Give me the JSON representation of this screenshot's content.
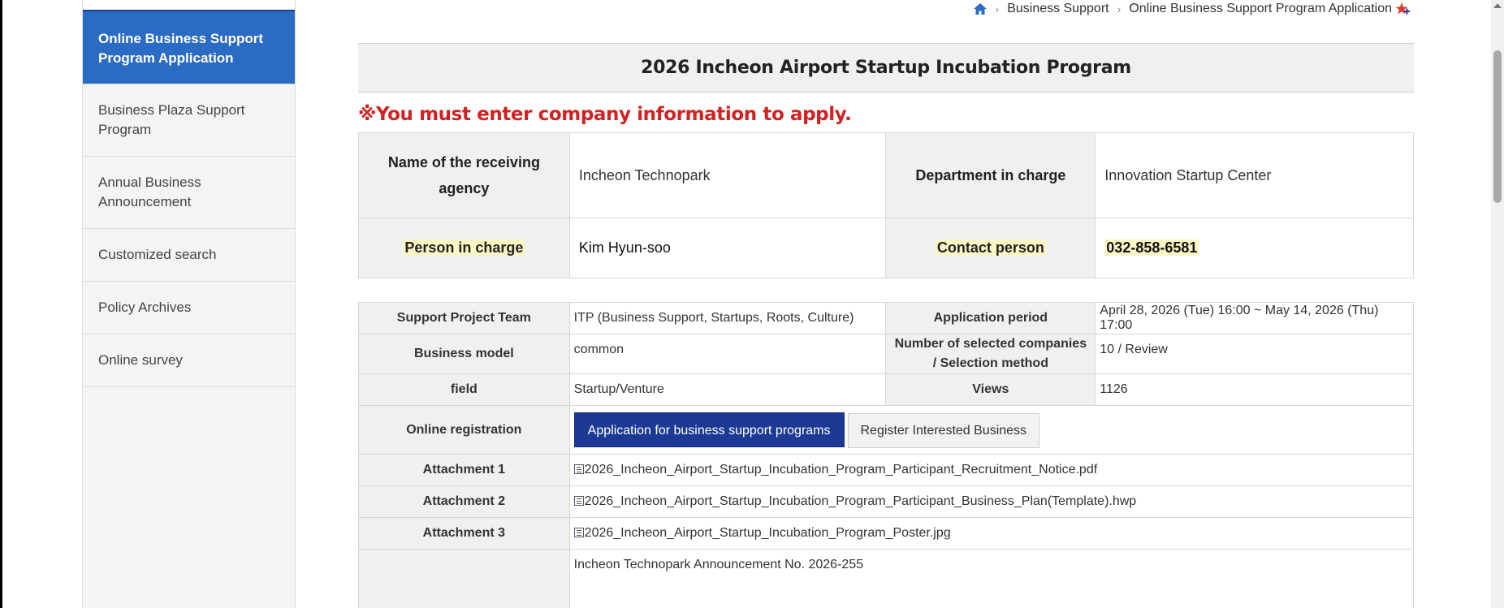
{
  "breadcrumb": {
    "items": [
      "Business Support",
      "Online Business Support Program Application"
    ]
  },
  "sidebar": {
    "items": [
      {
        "label": "Online Business Support Program Application"
      },
      {
        "label": "Business Plaza Support Program"
      },
      {
        "label": "Annual Business Announcement"
      },
      {
        "label": "Customized search"
      },
      {
        "label": "Policy Archives"
      },
      {
        "label": "Online survey"
      }
    ]
  },
  "page": {
    "title": "2026 Incheon Airport Startup Incubation Program",
    "notice": "※You must enter company information to apply."
  },
  "agency": {
    "receiving_agency_label": "Name of the receiving agency",
    "receiving_agency_value": "Incheon Technopark",
    "department_label": "Department in charge",
    "department_value": "Innovation Startup Center",
    "person_label": "Person in charge",
    "person_value": "Kim Hyun-soo",
    "contact_label": "Contact person",
    "contact_value": "032-858-6581"
  },
  "info": {
    "team_label": "Support Project Team",
    "team_value": "ITP (Business Support, Startups, Roots, Culture)",
    "period_label": "Application period",
    "period_value": "April 28, 2026 (Tue) 16:00 ~ May 14, 2026 (Thu) 17:00",
    "model_label": "Business model",
    "model_value": "common",
    "selected_label": "Number of selected companies / Selection method",
    "selected_value": "10 / Review",
    "field_label": "field",
    "field_value": "Startup/Venture",
    "views_label": "Views",
    "views_value": "1126",
    "registration_label": "Online registration",
    "apply_button": "Application for business support programs",
    "interest_button": "Register Interested Business",
    "attachments": [
      {
        "label": "Attachment 1",
        "file": "2026_Incheon_Airport_Startup_Incubation_Program_Participant_Recruitment_Notice.pdf"
      },
      {
        "label": "Attachment 2",
        "file": "2026_Incheon_Airport_Startup_Incubation_Program_Participant_Business_Plan(Template).hwp"
      },
      {
        "label": "Attachment 3",
        "file": "2026_Incheon_Airport_Startup_Incubation_Program_Poster.jpg"
      }
    ],
    "announcement_value": "Incheon Technopark Announcement No. 2026-255"
  },
  "colors": {
    "sidebar_active": "#2a6bc4",
    "notice_red": "#d42020",
    "primary_button": "#1c3a94",
    "highlight": "#fbf6c4"
  },
  "icons": [
    "home-icon",
    "chevron-right-icon",
    "star-add-icon",
    "file-icon"
  ]
}
